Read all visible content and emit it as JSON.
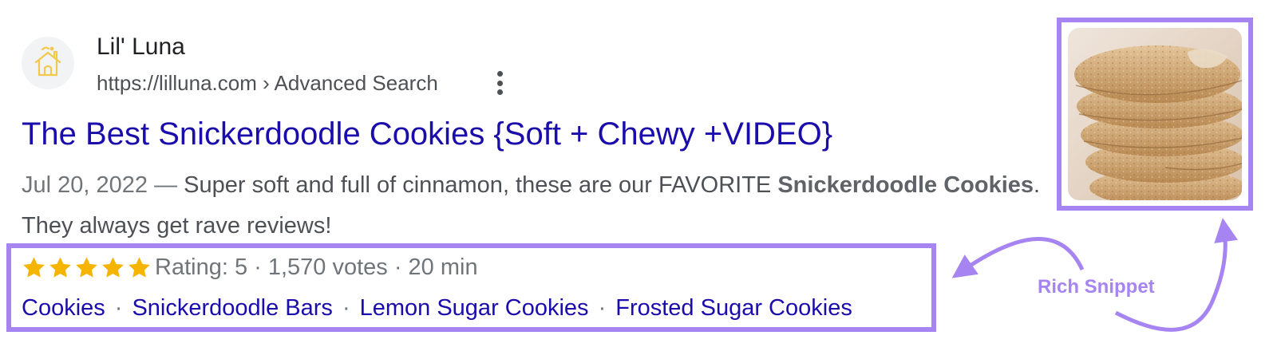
{
  "result": {
    "site_name": "Lil' Luna",
    "url": "https://lilluna.com › Advanced Search",
    "title": "The Best Snickerdoodle Cookies {Soft + Chewy +VIDEO}",
    "date": "Jul 20, 2022",
    "date_separator": " — ",
    "snippet_part1": "Super soft and full of cinnamon, these are our FAVORITE ",
    "snippet_bold": "Snickerdoodle Cookies",
    "snippet_part2": ". They always get rave reviews!"
  },
  "rich_snippet": {
    "stars_filled": 5,
    "stars_total": 5,
    "rating_text": "Rating: 5 · 1,570 votes · 20 min",
    "sitelinks": [
      "Cookies",
      "Snickerdoodle Bars",
      "Lemon Sugar Cookies",
      "Frosted Sugar Cookies"
    ],
    "sitelink_separator": "·"
  },
  "annotation": {
    "label": "Rich Snippet"
  },
  "colors": {
    "title_link": "#1a0dab",
    "annotation_purple": "#a684f2",
    "star_gold": "#f4b400",
    "body_text": "#4d5156"
  },
  "icons": {
    "favicon": "lil-luna-house-logo-icon",
    "more_menu": "more-vertical-icon",
    "star": "star-icon"
  }
}
